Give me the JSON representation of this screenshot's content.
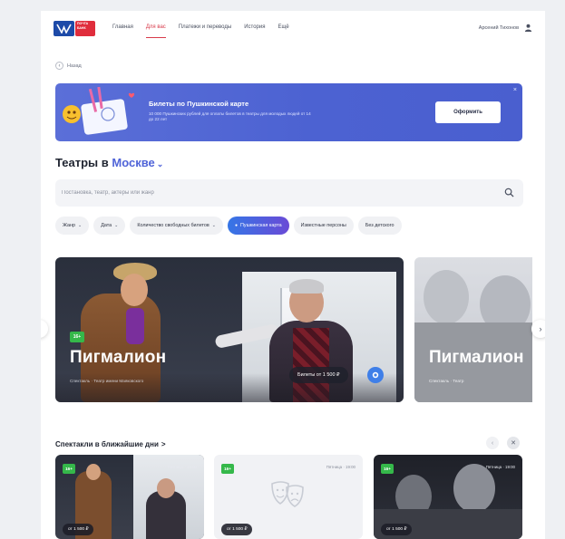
{
  "header": {
    "logo_text": "ПОЧТА БАНК",
    "nav": [
      {
        "label": "Главная",
        "active": false
      },
      {
        "label": "Для вас",
        "active": true
      },
      {
        "label": "Платежи и переводы",
        "active": false
      },
      {
        "label": "История",
        "active": false
      },
      {
        "label": "Ещё",
        "active": false
      }
    ],
    "user_name": "Арсений Тихонов"
  },
  "back_label": "Назад",
  "banner": {
    "title": "Билеты по Пушкинской карте",
    "subtitle": "10 000 Пушкинских рублей для оплаты билетов в театры для молодых людей от 14 до 22 лет",
    "button_label": "Оформить",
    "close": "×"
  },
  "page_title": {
    "prefix": "Театры в",
    "city": "Москве"
  },
  "search": {
    "placeholder": "Постановка, театр, актеры или жанр"
  },
  "filters": [
    {
      "label": "Жанр",
      "dropdown": true,
      "pushkin": false
    },
    {
      "label": "Дата",
      "dropdown": true,
      "pushkin": false
    },
    {
      "label": "Количество свободных билетов",
      "dropdown": true,
      "pushkin": false
    },
    {
      "label": "Пушкинская карта",
      "dropdown": false,
      "pushkin": true
    },
    {
      "label": "Известные персоны",
      "dropdown": false,
      "pushkin": false
    },
    {
      "label": "Без детского",
      "dropdown": false,
      "pushkin": false
    }
  ],
  "carousel": {
    "slides": [
      {
        "age": "16+",
        "title": "Пигмалион",
        "meta": "Спектакль · Театр имени Маяковского",
        "price": "Билеты от 1 500 ₽"
      },
      {
        "title": "Пигмалион",
        "meta": "Спектакль · Театр"
      }
    ],
    "prev": "‹",
    "next": "›"
  },
  "section": {
    "title": "Спектакли в ближайшие дни",
    "arrow": ">"
  },
  "cards": [
    {
      "age": "16+",
      "meta": "Пятница · 19:00",
      "price": "от 1 500 ₽"
    },
    {
      "age": "16+",
      "meta": "Пятница · 19:00",
      "price": "от 1 500 ₽"
    },
    {
      "age": "16+",
      "meta": "Пятница · 19:00",
      "price": "от 1 500 ₽"
    }
  ],
  "colors": {
    "accent_red": "#d83a4a",
    "accent_blue": "#5064d8",
    "age_green": "#35b84a"
  }
}
